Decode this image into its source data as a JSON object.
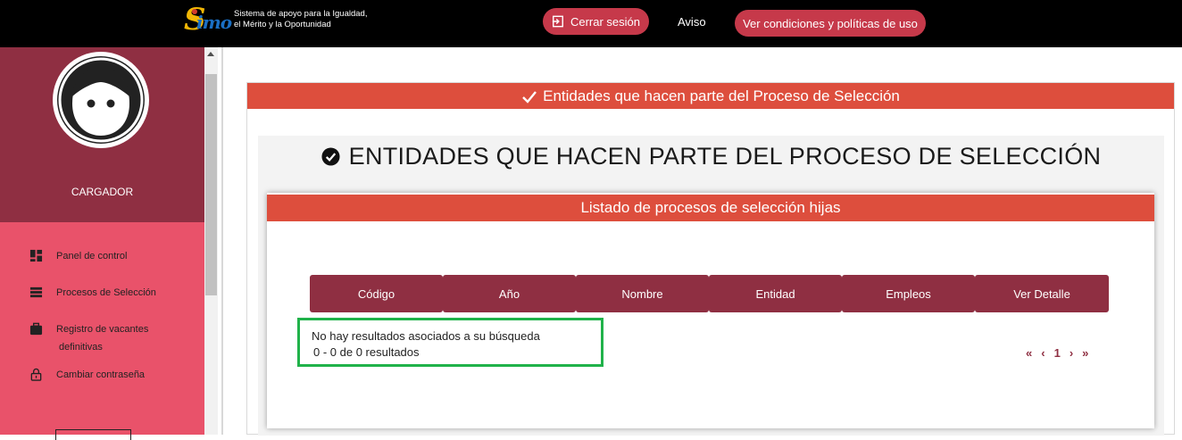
{
  "topbar": {
    "logo_text": "simo",
    "tagline_line1": "Sistema de apoyo para la Igualdad,",
    "tagline_line2": "el Mérito y la Oportunidad",
    "logout_label": "Cerrar sesión",
    "aviso_label": "Aviso",
    "terms_label": "Ver condiciones y políticas de uso"
  },
  "sidebar": {
    "profile_name": "CARGADOR",
    "items": [
      {
        "label": "Panel de control",
        "icon": "dashboard-icon"
      },
      {
        "label": "Procesos de Selección",
        "icon": "list-icon"
      },
      {
        "label": "Registro de vacantes",
        "label2": "definitivas",
        "icon": "briefcase-icon"
      },
      {
        "label": "Cambiar contraseña",
        "icon": "lock-icon"
      }
    ]
  },
  "panel": {
    "header": "Entidades que hacen parte del Proceso de Selección",
    "title": "ENTIDADES QUE HACEN PARTE DEL PROCESO DE SELECCIÓN",
    "card_header": "Listado de procesos de selección hijas",
    "columns": [
      "Código",
      "Año",
      "Nombre",
      "Entidad",
      "Empleos",
      "Ver Detalle"
    ],
    "no_results": "No hay resultados asociados a su búsqueda",
    "results_count": "0 - 0 de 0 resultados",
    "pager": {
      "first": "«",
      "prev": "‹",
      "page": "1",
      "next": "›",
      "last": "»"
    }
  },
  "colors": {
    "topbar_bg": "#000000",
    "accent_red": "#dd4e3d",
    "maroon": "#8f2f42",
    "sidebar_pink": "#e9526a",
    "highlight_green": "#20b24a"
  }
}
